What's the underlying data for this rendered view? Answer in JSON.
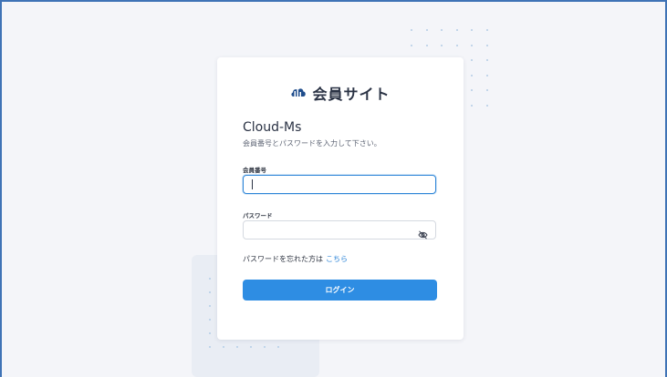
{
  "brand": {
    "title": "会員サイト",
    "logo_icon": "cloud-logo-icon"
  },
  "login": {
    "heading": "Cloud-Ms",
    "subtitle": "会員番号とパスワードを入力して下さい。",
    "member_id": {
      "label": "会員番号",
      "value": "",
      "placeholder": ""
    },
    "password": {
      "label": "パスワード",
      "value": "",
      "placeholder": "",
      "toggle_icon": "eye-slash-icon"
    },
    "forgot": {
      "text": "パスワードを忘れた方は",
      "link_text": "こちら"
    },
    "submit_label": "ログイン"
  },
  "colors": {
    "accent": "#2e8de3",
    "background": "#f4f5f9",
    "frame": "#3f73b6"
  }
}
